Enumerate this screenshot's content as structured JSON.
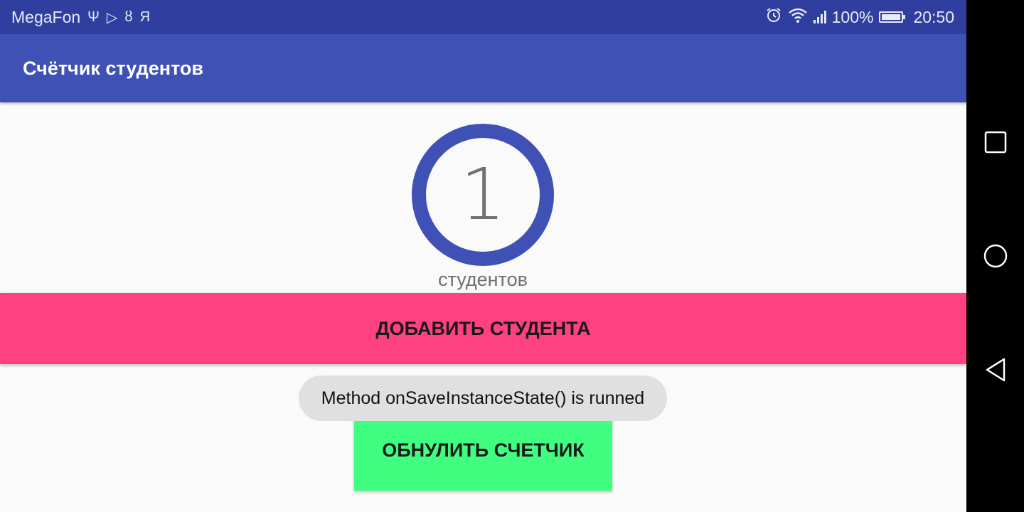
{
  "status_bar": {
    "carrier": "MegaFon",
    "left_icons": [
      "usb-icon",
      "play-store-icon",
      "odnoklassniki-icon",
      "yandex-icon"
    ],
    "usb_glyph": "Ψ",
    "play_glyph": "▷",
    "ok_glyph": "ȣ",
    "yandex_glyph": "Я",
    "battery_percent": "100%",
    "time": "20:50",
    "color": "#303f9f"
  },
  "app_bar": {
    "title": "Счётчик студентов",
    "color": "#3f51b5"
  },
  "counter": {
    "value": "1",
    "caption": "студентов",
    "ring_color": "#3f51b5"
  },
  "buttons": {
    "add_label": "ДОБАВИТЬ СТУДЕНТА",
    "add_color": "#ff4081",
    "reset_label": "ОБНУЛИТЬ СЧЕТЧИК",
    "reset_color": "#40ff80"
  },
  "toast": {
    "message": "Method onSaveInstanceState() is runned"
  },
  "nav_bar": {
    "icons": [
      "recents-square-icon",
      "home-circle-icon",
      "back-triangle-icon"
    ]
  }
}
